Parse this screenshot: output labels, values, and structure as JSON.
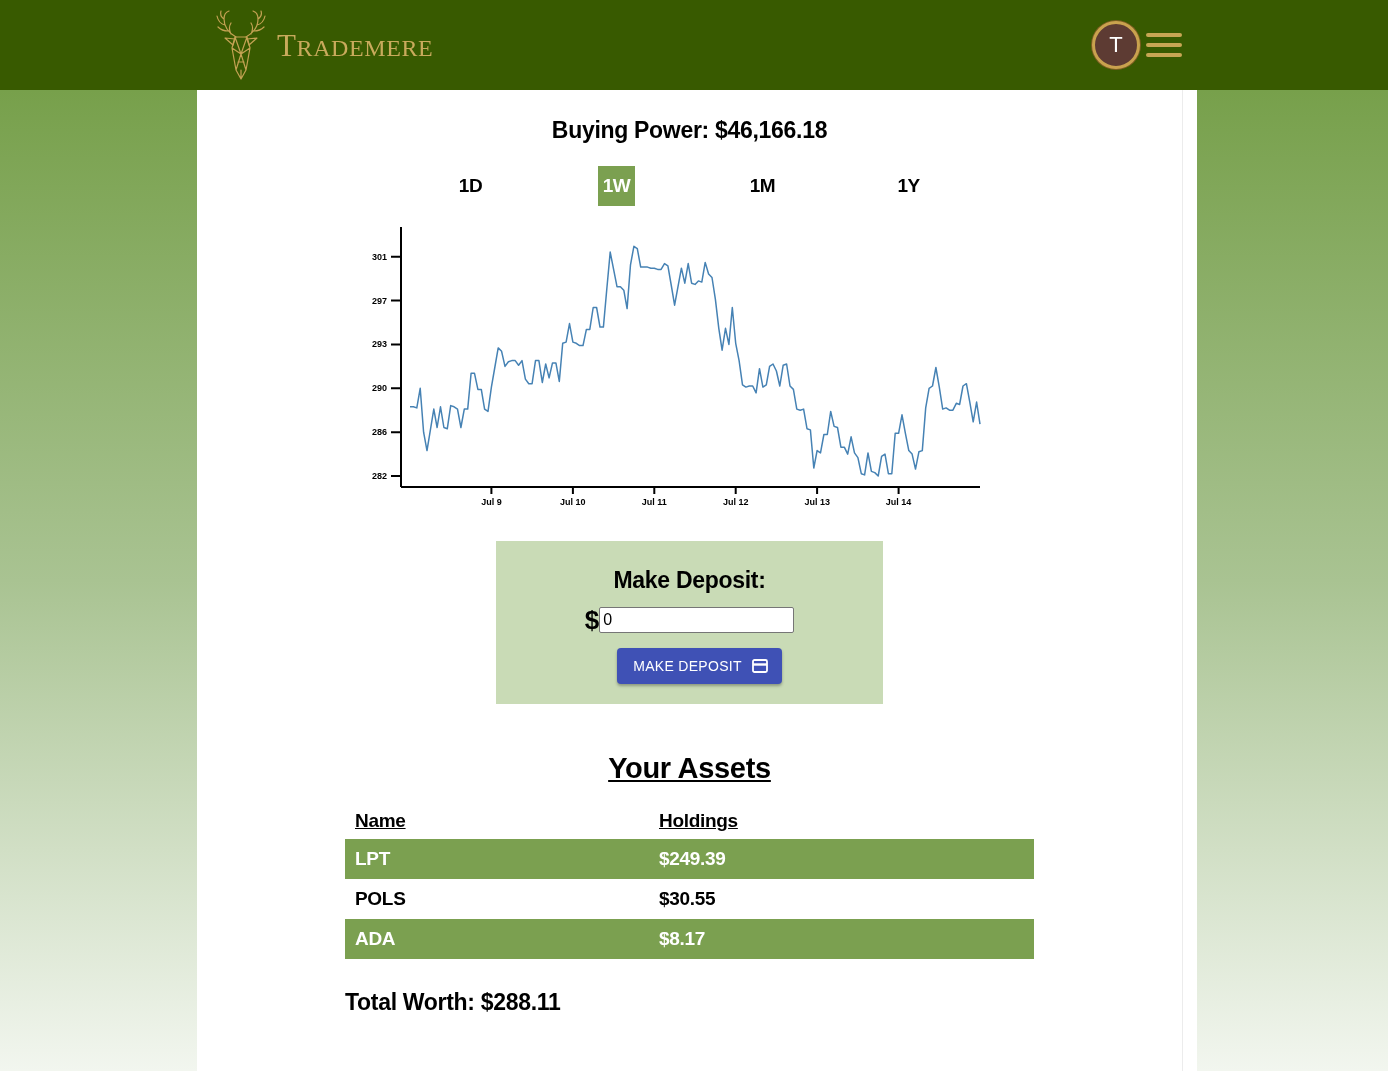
{
  "header": {
    "brand": "TRADEMERE",
    "avatar_initial": "T"
  },
  "buying_power": "Buying Power: $46,166.18",
  "range_tabs": [
    {
      "label": "1D",
      "selected": false
    },
    {
      "label": "1W",
      "selected": true
    },
    {
      "label": "1M",
      "selected": false
    },
    {
      "label": "1Y",
      "selected": false
    }
  ],
  "chart": {
    "chart_data": {
      "type": "line",
      "ylim": [
        281.05,
        303.57
      ],
      "yticks": [
        282,
        {
          "value": 285.8,
          "label": "286"
        },
        {
          "value": 289.6,
          "label": "290"
        },
        {
          "value": 293.4,
          "label": "293"
        },
        {
          "value": 297.2,
          "label": "297"
        },
        301
      ],
      "categories": [
        null,
        null,
        null,
        null,
        null,
        null,
        null,
        null,
        null,
        null,
        null,
        null,
        null,
        null,
        null,
        null,
        null,
        null,
        null,
        null,
        null,
        null,
        null,
        null,
        "Jul 9",
        null,
        null,
        null,
        null,
        null,
        null,
        null,
        null,
        null,
        null,
        null,
        null,
        null,
        null,
        null,
        null,
        null,
        null,
        null,
        null,
        null,
        null,
        null,
        "Jul 10",
        null,
        null,
        null,
        null,
        null,
        null,
        null,
        null,
        null,
        null,
        null,
        null,
        null,
        null,
        null,
        null,
        null,
        null,
        null,
        null,
        null,
        null,
        null,
        "Jul 11",
        null,
        null,
        null,
        null,
        null,
        null,
        null,
        null,
        null,
        null,
        null,
        null,
        null,
        null,
        null,
        null,
        null,
        null,
        null,
        null,
        null,
        null,
        null,
        "Jul 12",
        null,
        null,
        null,
        null,
        null,
        null,
        null,
        null,
        null,
        null,
        null,
        null,
        null,
        null,
        null,
        null,
        null,
        null,
        null,
        null,
        null,
        null,
        null,
        "Jul 13",
        null,
        null,
        null,
        null,
        null,
        null,
        null,
        null,
        null,
        null,
        null,
        null,
        null,
        null,
        null,
        null,
        null,
        null,
        null,
        null,
        null,
        null,
        null,
        "Jul 14",
        null,
        null,
        null,
        null,
        null,
        null,
        null,
        null,
        null,
        null,
        null,
        null,
        null,
        null,
        null,
        null,
        null,
        null,
        null,
        null,
        null,
        null,
        null,
        null
      ],
      "series": [
        {
          "color": "#4682b4",
          "values": [
            288.0,
            288.0,
            287.9,
            289.6,
            285.8,
            284.2,
            286.0,
            287.8,
            286.2,
            288.0,
            286.2,
            286.1,
            288.1,
            288.0,
            287.8,
            286.2,
            287.8,
            287.8,
            290.9,
            290.9,
            289.5,
            289.5,
            287.8,
            287.6,
            289.7,
            291.4,
            293.1,
            292.8,
            291.5,
            291.9,
            292.0,
            292.0,
            291.6,
            292.0,
            290.4,
            290.0,
            290.0,
            292.0,
            292.0,
            290.1,
            291.7,
            290.5,
            291.8,
            291.8,
            290.2,
            293.5,
            293.6,
            295.2,
            293.6,
            293.5,
            293.3,
            293.3,
            294.7,
            294.7,
            296.6,
            296.6,
            294.9,
            294.9,
            298.2,
            301.4,
            299.9,
            298.4,
            298.4,
            298.1,
            296.5,
            300.3,
            301.9,
            301.7,
            300.1,
            300.1,
            300.1,
            300.0,
            300.0,
            299.9,
            299.9,
            300.4,
            300.2,
            298.5,
            296.8,
            298.4,
            300.0,
            298.7,
            300.4,
            298.7,
            298.6,
            298.9,
            298.8,
            300.5,
            299.5,
            299.2,
            297.3,
            294.8,
            292.9,
            294.8,
            293.4,
            296.6,
            293.5,
            292.0,
            289.9,
            289.7,
            289.8,
            289.8,
            289.2,
            291.3,
            289.7,
            289.9,
            291.5,
            291.7,
            291.1,
            289.8,
            291.6,
            291.7,
            289.8,
            289.5,
            287.8,
            287.7,
            287.8,
            286.1,
            286.0,
            282.7,
            284.2,
            284.0,
            285.6,
            285.6,
            287.6,
            286.3,
            286.2,
            284.5,
            284.5,
            283.9,
            285.4,
            284.0,
            283.6,
            282.2,
            282.1,
            284.0,
            282.4,
            282.3,
            282.0,
            283.7,
            283.9,
            282.2,
            282.2,
            285.7,
            285.7,
            287.3,
            285.7,
            284.2,
            283.9,
            282.6,
            284.1,
            284.2,
            287.9,
            289.6,
            289.8,
            291.4,
            289.7,
            287.8,
            287.9,
            287.7,
            287.7,
            288.3,
            288.2,
            289.8,
            290.0,
            288.4,
            286.7,
            288.4,
            286.5
          ]
        }
      ]
    }
  },
  "deposit": {
    "title": "Make Deposit:",
    "currency": "$",
    "amount_field": {
      "value": "0"
    },
    "button": "MAKE DEPOSIT"
  },
  "assets": {
    "title": "Your Assets",
    "columns": [
      "Name",
      "Holdings"
    ],
    "rows": [
      {
        "name": "LPT",
        "holdings": "$249.39"
      },
      {
        "name": "POLS",
        "holdings": "$30.55"
      },
      {
        "name": "ADA",
        "holdings": "$8.17"
      }
    ]
  },
  "total_worth": "Total Worth: $288.11"
}
